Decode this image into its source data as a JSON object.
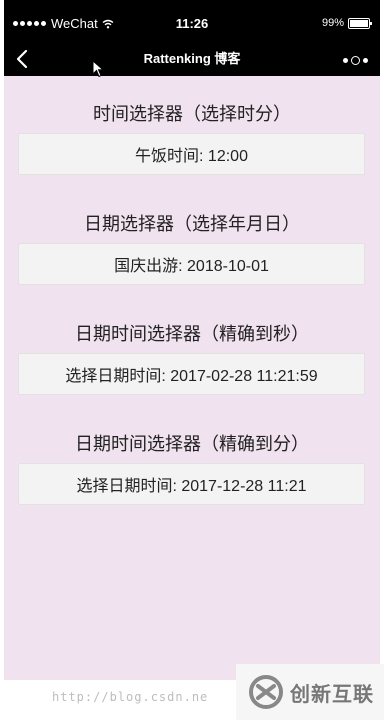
{
  "status_bar": {
    "carrier": "WeChat",
    "time": "11:26",
    "battery": "99%"
  },
  "nav": {
    "title": "Rattenking 博客"
  },
  "sections": [
    {
      "title": "时间选择器（选择时分）",
      "field": "午饭时间: 12:00"
    },
    {
      "title": "日期选择器（选择年月日）",
      "field": "国庆出游: 2018-10-01"
    },
    {
      "title": "日期时间选择器（精确到秒）",
      "field": "选择日期时间: 2017-02-28 11:21:59"
    },
    {
      "title": "日期时间选择器（精确到分）",
      "field": "选择日期时间: 2017-12-28 11:21"
    }
  ],
  "watermark": {
    "url": "http://blog.csdn.ne",
    "logo_text": "创新互联"
  },
  "colors": {
    "page_bg": "#f0e2ef",
    "bar_bg": "#000000",
    "field_bg": "#f3f3f3"
  }
}
